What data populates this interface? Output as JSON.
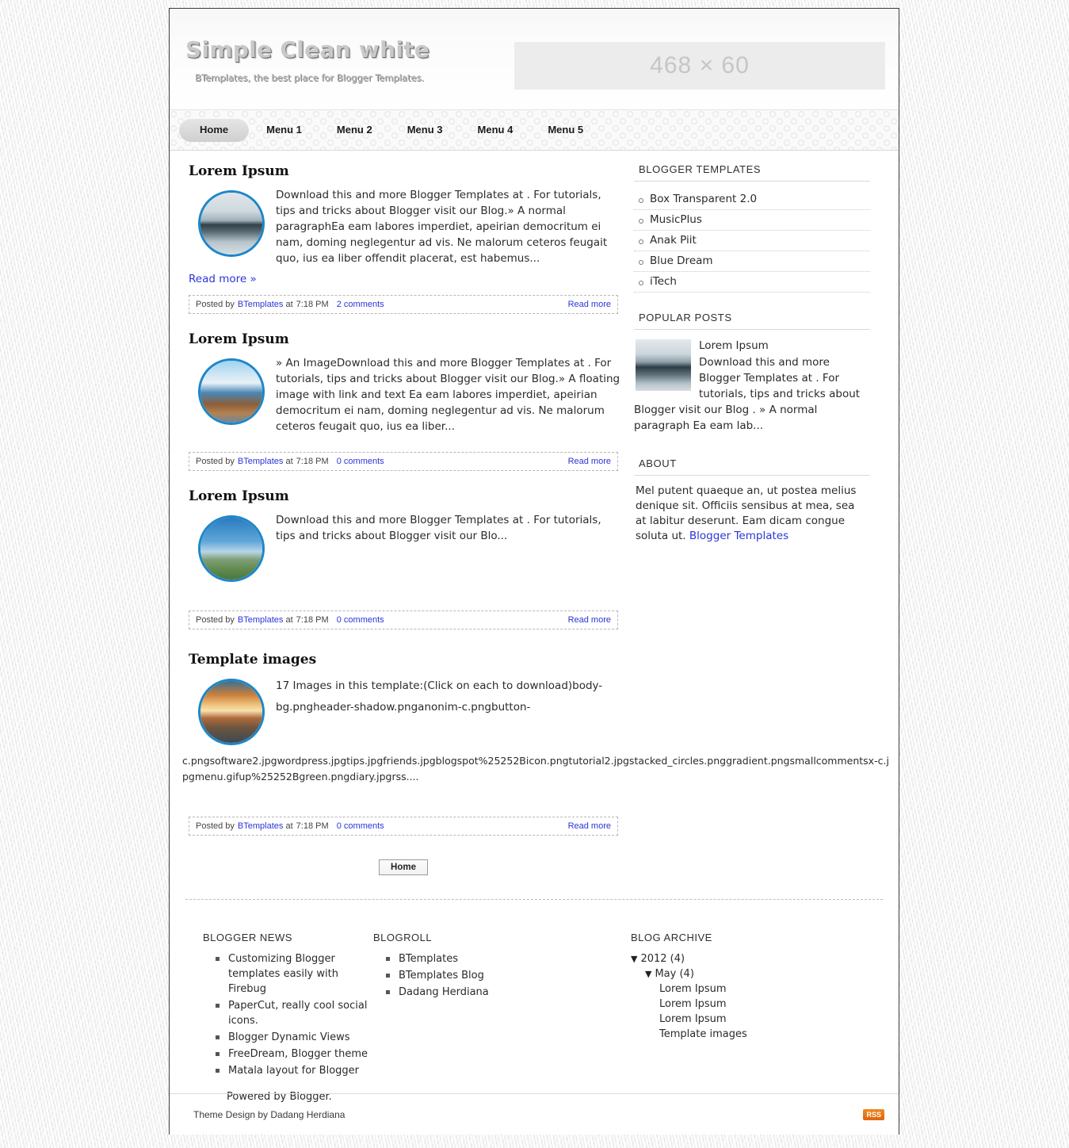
{
  "header": {
    "blog_title": "Simple Clean white",
    "blog_description": "BTemplates, the best place for Blogger Templates.",
    "banner_label": "468 × 60"
  },
  "nav": {
    "items": [
      {
        "label": "Home",
        "active": true
      },
      {
        "label": "Menu 1",
        "active": false
      },
      {
        "label": "Menu 2",
        "active": false
      },
      {
        "label": "Menu 3",
        "active": false
      },
      {
        "label": "Menu 4",
        "active": false
      },
      {
        "label": "Menu 5",
        "active": false
      }
    ]
  },
  "posts": [
    {
      "title": "Lorem Ipsum",
      "body": "Download this and more Blogger Templates at . For tutorials, tips and tricks about Blogger visit our Blog.» A normal paragraphEa eam labores imperdiet, apeirian democritum ei nam, doming neglegentur ad vis. Ne malorum ceteros feugait quo, ius ea liber offendit placerat, est habemus...",
      "read_more_inline": "Read more »",
      "posted_by_prefix": "Posted by",
      "author": "BTemplates",
      "time_prefix": "at",
      "time": "7:18 PM",
      "comments": "2 comments",
      "read_more": "Read more"
    },
    {
      "title": "Lorem Ipsum",
      "body": "» An ImageDownload this and more Blogger Templates at . For tutorials, tips and tricks about Blogger visit our Blog.» A floating image with link and text Ea eam labores imperdiet, apeirian democritum ei nam, doming neglegentur ad vis. Ne malorum ceteros feugait quo, ius ea liber...",
      "posted_by_prefix": "Posted by",
      "author": "BTemplates",
      "time_prefix": "at",
      "time": "7:18 PM",
      "comments": "0 comments",
      "read_more": "Read more"
    },
    {
      "title": "Lorem Ipsum",
      "body": "Download this and more Blogger Templates at . For tutorials, tips and tricks about Blogger visit our Blo...",
      "posted_by_prefix": "Posted by",
      "author": "BTemplates",
      "time_prefix": "at",
      "time": "7:18 PM",
      "comments": "0 comments",
      "read_more": "Read more"
    },
    {
      "title": "Template images",
      "body": "17 Images in this template:(Click on each to download)body-bg.pngheader-shadow.pnganonim-c.pngbutton-",
      "overflow_body": "c.pngsoftware2.jpgwordpress.jpgtips.jpgfriends.jpgblogspot%25252Bicon.pngtutorial2.jpgstacked_circles.pnggradient.pngsmallcommentsx-c.jpgmenu.gifup%25252Bgreen.pngdiary.jpgrss....",
      "posted_by_prefix": "Posted by",
      "author": "BTemplates",
      "time_prefix": "at",
      "time": "7:18 PM",
      "comments": "0 comments",
      "read_more": "Read more"
    }
  ],
  "pagination": {
    "home_button": "Home"
  },
  "sidebar": {
    "templates": {
      "heading": "BLOGGER TEMPLATES",
      "items": [
        {
          "label": "Box Transparent 2.0"
        },
        {
          "label": "MusicPlus"
        },
        {
          "label": "Anak Piit"
        },
        {
          "label": "Blue Dream"
        },
        {
          "label": "iTech"
        }
      ]
    },
    "popular": {
      "heading": "POPULAR POSTS",
      "post_title": "Lorem Ipsum",
      "post_text": "Download this and more Blogger Templates at . For tutorials, tips and tricks about Blogger visit our Blog . » A normal paragraph Ea eam lab..."
    },
    "about": {
      "heading": "ABOUT",
      "text": "Mel putent quaeque an, ut postea melius denique sit. Officiis sensibus at mea, sea at labitur deserunt. Eam dicam congue soluta ut.",
      "link": "Blogger Templates"
    }
  },
  "footer": {
    "news": {
      "heading": "BLOGGER NEWS",
      "items": [
        {
          "label": "Customizing Blogger templates easily with Firebug"
        },
        {
          "label": "PaperCut, really cool social icons."
        },
        {
          "label": "Blogger Dynamic Views"
        },
        {
          "label": "FreeDream, Blogger theme"
        },
        {
          "label": "Matala layout for Blogger"
        }
      ],
      "powered_by": "Powered by Blogger."
    },
    "blogroll": {
      "heading": "BLOGROLL",
      "items": [
        {
          "label": "BTemplates"
        },
        {
          "label": "BTemplates Blog"
        },
        {
          "label": "Dadang Herdiana"
        }
      ]
    },
    "archive": {
      "heading": "BLOG ARCHIVE",
      "year": {
        "triangle": "▼",
        "label": "2012 (4)"
      },
      "month": {
        "triangle": "▼",
        "label": "May (4)"
      },
      "entries": [
        {
          "label": "Lorem Ipsum"
        },
        {
          "label": "Lorem Ipsum"
        },
        {
          "label": "Lorem Ipsum"
        },
        {
          "label": "Template images"
        }
      ]
    },
    "credit": "Theme Design by Dadang Herdiana",
    "rss_label": "RSS"
  }
}
